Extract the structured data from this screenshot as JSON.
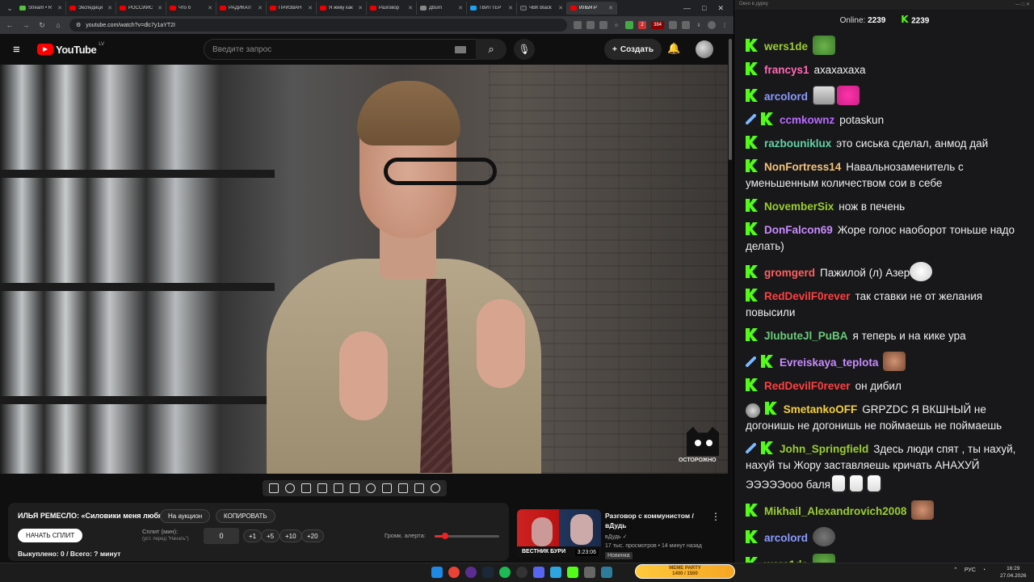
{
  "browser": {
    "tabs": [
      {
        "label": "Stream • R",
        "fav": "green",
        "active": false
      },
      {
        "label": "Экспедици",
        "fav": "red",
        "active": false
      },
      {
        "label": "РОССИЙС",
        "fav": "red",
        "active": false
      },
      {
        "label": "Что б",
        "fav": "red",
        "active": false
      },
      {
        "label": "РАДИКАЛ",
        "fav": "red",
        "active": false
      },
      {
        "label": "ПРИЗВАН",
        "fav": "red",
        "active": false
      },
      {
        "label": "Я живу как",
        "fav": "red",
        "active": false
      },
      {
        "label": "Разговор",
        "fav": "red",
        "active": false
      },
      {
        "label": "Дburn",
        "fav": "grey",
        "active": false
      },
      {
        "label": "ТВИТТЕР",
        "fav": "blue",
        "active": false
      },
      {
        "label": "ЧВК Black",
        "fav": "dark",
        "active": false
      },
      {
        "label": "ИЛЬЯ Р",
        "fav": "red",
        "active": true
      }
    ],
    "url": "youtube.com/watch?v=dlc7y1aYT2I",
    "ext_badge_1": "2",
    "ext_badge_2": "384"
  },
  "youtube": {
    "logo_text": "YouTube",
    "region": "LV",
    "search_placeholder": "Введите запрос",
    "create_label": "Создать"
  },
  "video": {
    "watermark": "ОСТОРОЖНО"
  },
  "widget": {
    "title": "ИЛЬЯ РЕМЕСЛО: «Силовики меня любят»",
    "auction_label": "На аукцион",
    "copy_label": "КОПИРОВАТЬ",
    "start_split_label": "НАЧАТЬ СПЛИТ",
    "split_label": "Сплит (мин):",
    "split_hint": "(уст. перед \"Начать\")",
    "split_value": "0",
    "increments": [
      "+1",
      "+5",
      "+10",
      "+20"
    ],
    "volume_label": "Громк. алерта:",
    "volume_level": 0.16,
    "bought_label": "Выкуплено: 0 / Всего: ? минут"
  },
  "recommendation": {
    "title": "Разговор с коммунистом / вДудь",
    "channel": "вДудь",
    "meta": "17 тыс. просмотров • 14 минут назад",
    "badge": "Новинка",
    "thumb_caption": "ВЕСТНИК БУРИ",
    "duration": "3:23:06"
  },
  "chat": {
    "window_title": "Окно в дурку",
    "online_label": "Online:",
    "online_count": "2239",
    "viewer_count": "2239",
    "messages": [
      {
        "user": "wers1de",
        "color": "#9acd32",
        "text": "",
        "sword": false,
        "emotes": [
          "em-pepe"
        ]
      },
      {
        "user": "francys1",
        "color": "#ff69b4",
        "text": "ахахахаха",
        "sword": false,
        "emotes": []
      },
      {
        "user": "arcolord",
        "color": "#8a9bff",
        "text": "",
        "sword": false,
        "emotes": [
          "em-simp",
          "em-pink"
        ]
      },
      {
        "user": "ccmkownz",
        "color": "#b86aff",
        "text": "potaskun",
        "sword": true,
        "emotes": []
      },
      {
        "user": "razbouniklux",
        "color": "#5fd3a5",
        "text": "это сиська сделал, анмод дай",
        "sword": false,
        "emotes": []
      },
      {
        "user": "NonFortress14",
        "color": "#f4c27a",
        "text": "Навальнозаменитель с уменьшенным количеством сои в себе",
        "sword": false,
        "emotes": []
      },
      {
        "user": "NovemberSix",
        "color": "#9acd32",
        "text": "нож в печень",
        "sword": false,
        "emotes": []
      },
      {
        "user": "DonFalcon69",
        "color": "#c98bff",
        "text": "Жоре голос наоборот тоньше надо делать)",
        "sword": false,
        "emotes": []
      },
      {
        "user": "gromgerd",
        "color": "#ff5f5f",
        "text": "Пажилой (л) Азер",
        "sword": false,
        "emotes": [
          "em-mask"
        ]
      },
      {
        "user": "RedDevilF0rever",
        "color": "#ff4040",
        "text": "так ставки не от желания повысили",
        "sword": false,
        "emotes": []
      },
      {
        "user": "JlubuteJl_PuBA",
        "color": "#6bcb7a",
        "text": "я теперь и на кике ура",
        "sword": false,
        "emotes": []
      },
      {
        "user": "Evreiskaya_teplota",
        "color": "#c98bff",
        "text": "",
        "sword": true,
        "emotes": [
          "em-face"
        ]
      },
      {
        "user": "RedDevilF0rever",
        "color": "#ff4040",
        "text": "он дибил",
        "sword": false,
        "emotes": []
      },
      {
        "user": "SmetankoOFF",
        "color": "#f4d03f",
        "text": "GRPZDC Я ВКШНЫЙ не догонишь не догонишь не поймаешь не поймаешь",
        "sword": false,
        "emotes": [],
        "mini": true
      },
      {
        "user": "John_Springfield",
        "color": "#9acd32",
        "text": "Здесь люди спят , ты нахуй, нахуй ты Жору заставляешь кричать АНАХУЙ ЭЭЭЭЭооо баля",
        "sword": true,
        "emotes": [
          "em-milk",
          "em-milk",
          "em-milk"
        ]
      },
      {
        "user": "Mikhail_Alexandrovich2008",
        "color": "#9acd32",
        "text": "",
        "sword": false,
        "emotes": [
          "em-face"
        ]
      },
      {
        "user": "arcolord",
        "color": "#8a9bff",
        "text": "",
        "sword": false,
        "emotes": [
          "em-frog"
        ]
      },
      {
        "user": "wers1de",
        "color": "#9acd32",
        "text": "",
        "sword": false,
        "emotes": [
          "em-pepe"
        ]
      }
    ]
  },
  "taskbar": {
    "meme_title": "MEME PARTY",
    "meme_progress": "1400 / 1500",
    "lang": "РУС",
    "time": "16:29",
    "date": "27.04.2026"
  }
}
